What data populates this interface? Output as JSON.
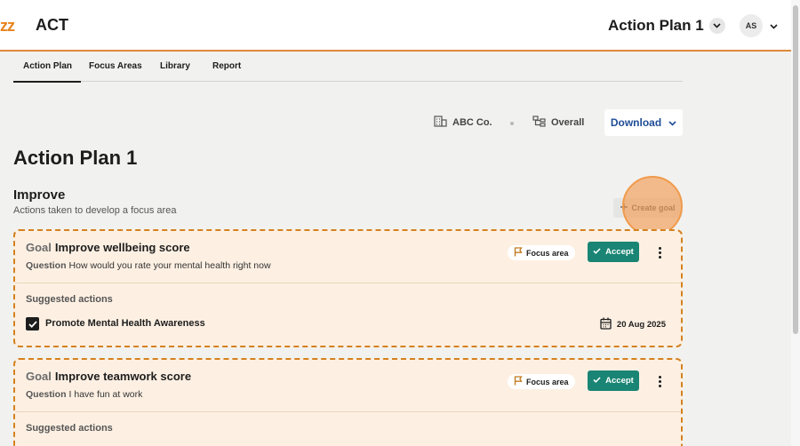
{
  "header": {
    "logo_text": "zz",
    "app_name": "ACT",
    "plan_selector": "Action Plan 1",
    "avatar_initials": "AS"
  },
  "tabs": [
    {
      "label": "Action Plan",
      "active": true
    },
    {
      "label": "Focus Areas",
      "active": false
    },
    {
      "label": "Library",
      "active": false
    },
    {
      "label": "Report",
      "active": false
    }
  ],
  "filters": {
    "company": "ABC Co.",
    "scope": "Overall",
    "download_label": "Download"
  },
  "page": {
    "title": "Action Plan 1",
    "section_title": "Improve",
    "section_subtitle": "Actions taken to develop a focus area",
    "create_goal_label": "Create goal"
  },
  "goals": [
    {
      "keyword": "Goal",
      "title": "Improve wellbeing score",
      "question_keyword": "Question",
      "question": "How would you rate your mental health right now",
      "focus_badge": "Focus area",
      "accept_label": "Accept",
      "suggested_label": "Suggested actions",
      "action": "Promote Mental Health Awareness",
      "action_checked": true,
      "due_date": "20 Aug 2025"
    },
    {
      "keyword": "Goal",
      "title": "Improve teamwork score",
      "question_keyword": "Question",
      "question": "I have fun at work",
      "focus_badge": "Focus area",
      "accept_label": "Accept",
      "suggested_label": "Suggested actions"
    }
  ],
  "colors": {
    "accent_orange": "#e0893a",
    "accept_green": "#1a8574",
    "download_blue": "#1f4d97",
    "card_bg": "#fdf0e3"
  }
}
